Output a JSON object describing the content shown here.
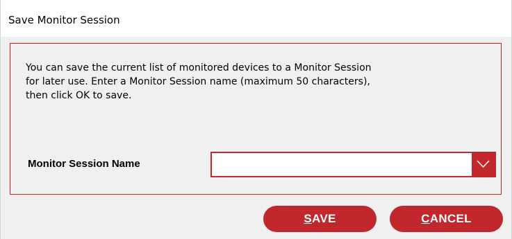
{
  "window": {
    "title": "Save Monitor Session"
  },
  "content": {
    "description": "You can save the current list of monitored devices to a Monitor Session\nfor later use.  Enter a Monitor Session name (maximum 50 characters),\nthen click OK to save.",
    "field_label": "Monitor Session Name",
    "field_value": "",
    "dropdown_icon": "chevron-down-icon"
  },
  "buttons": {
    "save_mnemonic": "S",
    "save_rest": "AVE",
    "cancel_mnemonic": "C",
    "cancel_rest": "ANCEL"
  },
  "colors": {
    "accent": "#c1272d",
    "background": "#f0f0f0",
    "titlebar": "#ffffff"
  }
}
